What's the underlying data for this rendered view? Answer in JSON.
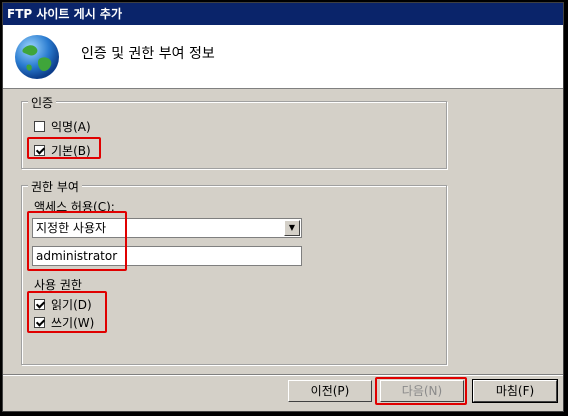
{
  "window": {
    "title": "FTP 사이트 게시 추가"
  },
  "header": {
    "title": "인증 및 권한 부여 정보",
    "icon": "globe-icon"
  },
  "auth": {
    "legend": "인증",
    "anonymous_label": "익명(A)",
    "anonymous_checked": false,
    "basic_label": "기본(B)",
    "basic_checked": true
  },
  "authorization": {
    "legend": "권한 부여",
    "access_label": "액세스 허용(C):",
    "access_selected": "지정한 사용자",
    "user_value": "administrator",
    "perm_label": "사용 권한",
    "read_label": "읽기(D)",
    "read_checked": true,
    "write_label": "쓰기(W)",
    "write_checked": true
  },
  "buttons": {
    "prev": "이전(P)",
    "next": "다음(N)",
    "finish": "마침(F)"
  },
  "colors": {
    "highlight": "#e00000",
    "titlebar": "#0a246a",
    "dialog": "#d4d0c8"
  }
}
